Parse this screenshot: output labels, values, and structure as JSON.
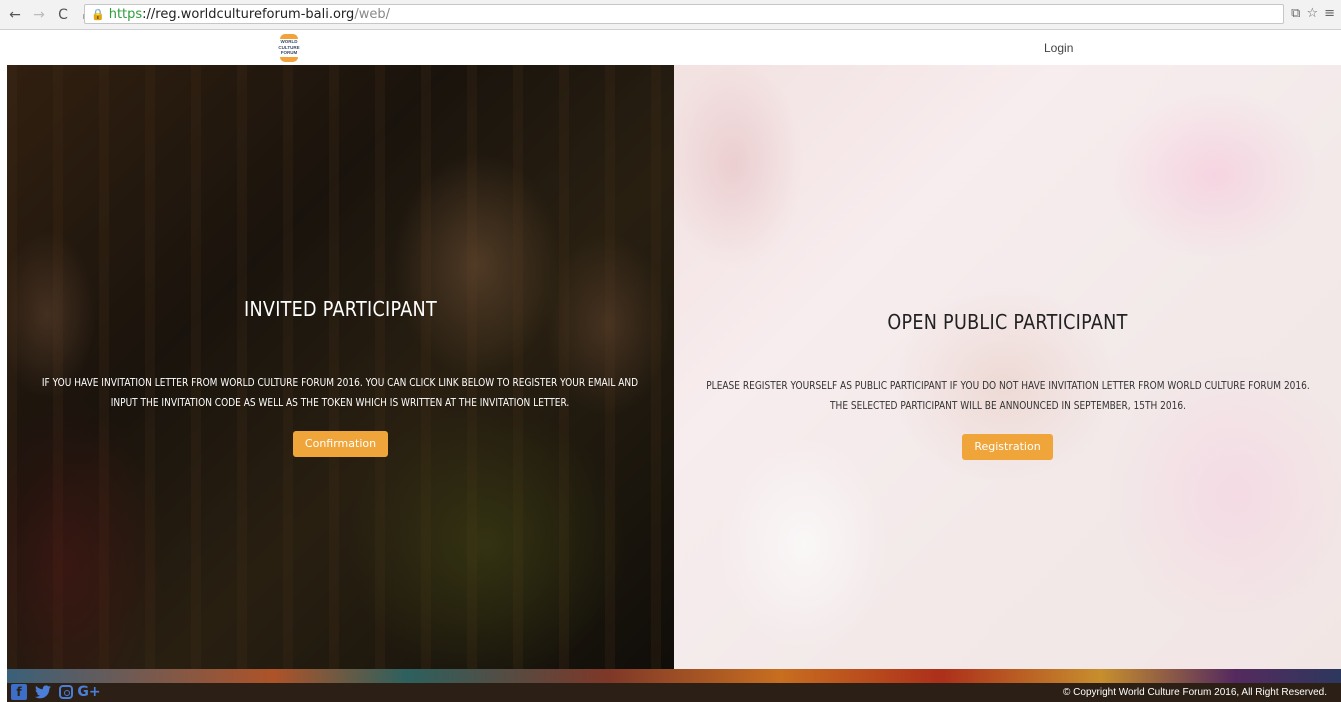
{
  "browser": {
    "back_icon": "←",
    "forward_icon": "→",
    "reload_icon": "C",
    "home_icon": "⌂",
    "url_scheme": "https",
    "url_host": "://reg.worldcultureforum-bali.org",
    "url_path": "/web/"
  },
  "header": {
    "logo_text": "WORLD CULTURE FORUM",
    "login_label": "Login"
  },
  "panels": {
    "invited": {
      "title": "INVITED PARTICIPANT",
      "description": "IF YOU HAVE INVITATION LETTER FROM WORLD CULTURE FORUM 2016. YOU CAN CLICK LINK BELOW TO REGISTER YOUR EMAIL AND INPUT THE INVITATION CODE AS WELL AS THE TOKEN WHICH IS WRITTEN AT THE INVITATION LETTER.",
      "button_label": "Confirmation"
    },
    "public": {
      "title": "OPEN PUBLIC PARTICIPANT",
      "description": "PLEASE REGISTER YOURSELF AS PUBLIC PARTICIPANT IF YOU DO NOT HAVE INVITATION LETTER FROM WORLD CULTURE FORUM 2016. THE SELECTED PARTICIPANT WILL BE ANNOUNCED IN SEPTEMBER, 15TH 2016.",
      "button_label": "Registration"
    }
  },
  "footer": {
    "social": [
      "facebook-icon",
      "twitter-icon",
      "instagram-icon",
      "google-plus-icon"
    ],
    "copyright": "© Copyright World Culture Forum 2016, All Right Reserved."
  },
  "colors": {
    "accent": "#f0a53a",
    "social": "#4a7ed8"
  }
}
